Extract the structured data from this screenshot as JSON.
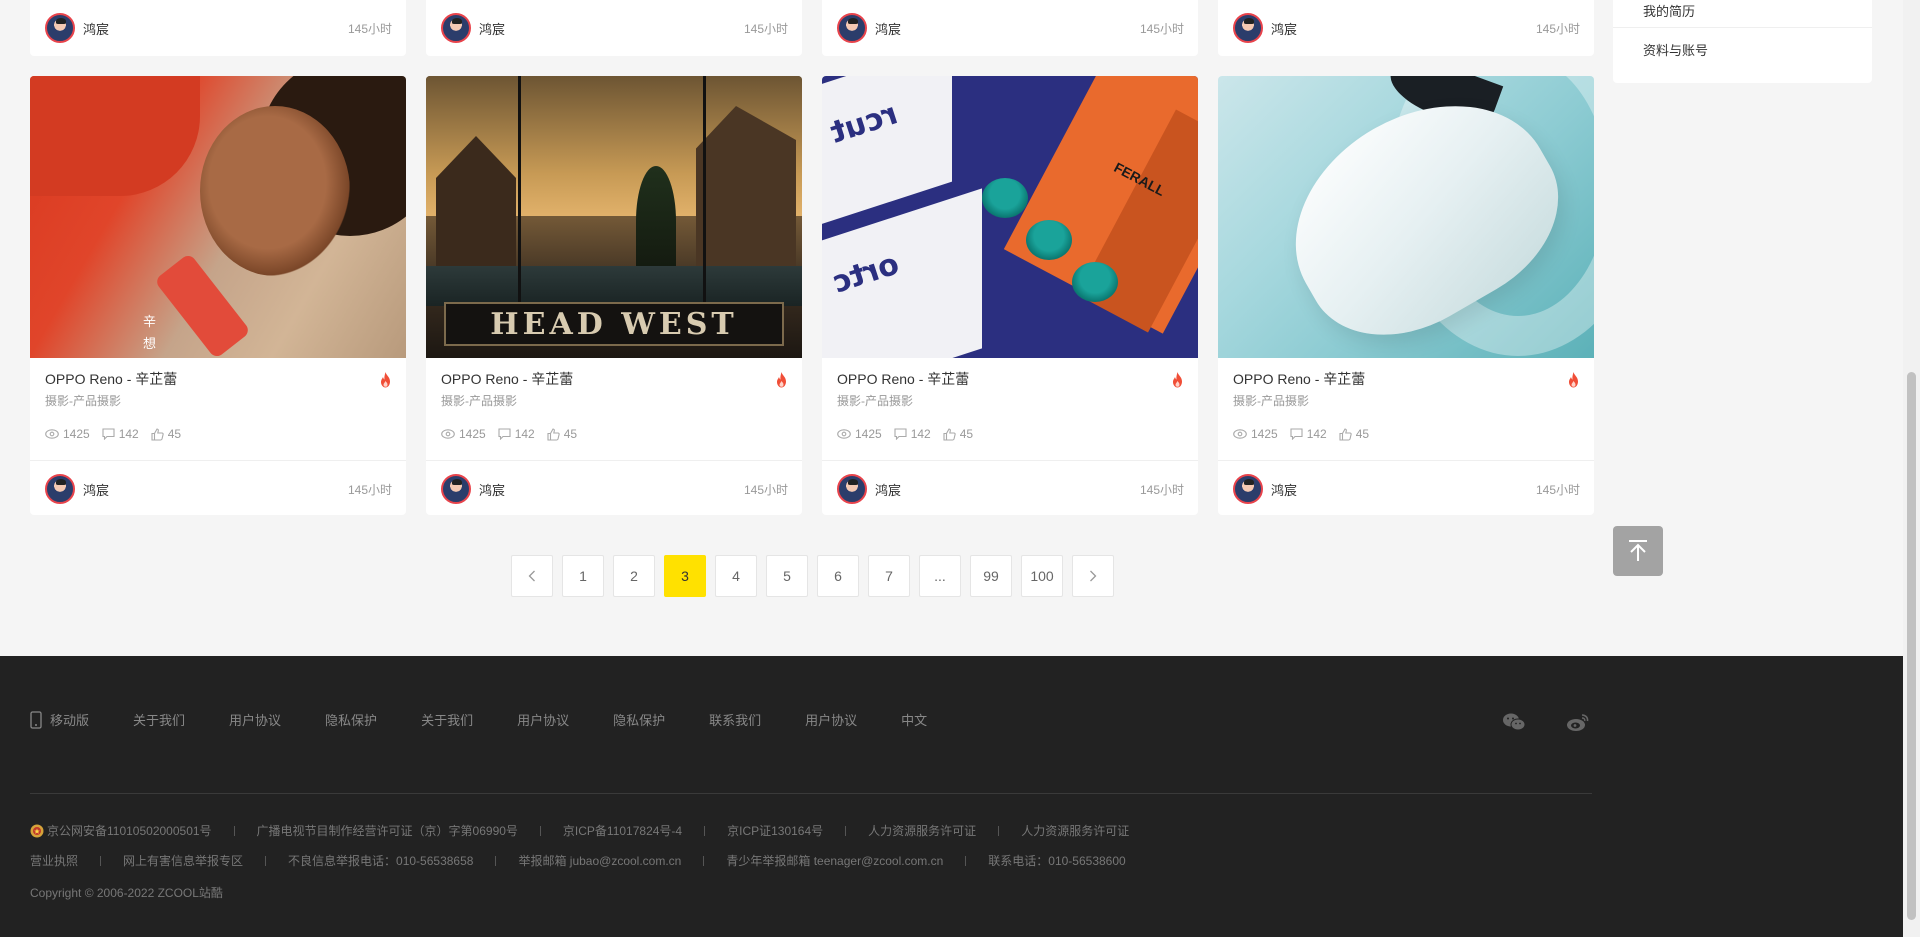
{
  "top_cards": [
    {
      "author": "鸿宸",
      "time": "145小时"
    },
    {
      "author": "鸿宸",
      "time": "145小时"
    },
    {
      "author": "鸿宸",
      "time": "145小时"
    },
    {
      "author": "鸿宸",
      "time": "145小时"
    }
  ],
  "cards": [
    {
      "title": "OPPO Reno - 辛芷蕾",
      "category": "摄影-产品摄影",
      "views": "1425",
      "comments": "142",
      "likes": "45",
      "author": "鸿宸",
      "time": "145小时",
      "thumb_text": "辛\n想"
    },
    {
      "title": "OPPO Reno - 辛芷蕾",
      "category": "摄影-产品摄影",
      "views": "1425",
      "comments": "142",
      "likes": "45",
      "author": "鸿宸",
      "time": "145小时",
      "thumb_text": "HEAD WEST"
    },
    {
      "title": "OPPO Reno - 辛芷蕾",
      "category": "摄影-产品摄影",
      "views": "1425",
      "comments": "142",
      "likes": "45",
      "author": "鸿宸",
      "time": "145小时",
      "thumb_text": "FERALL"
    },
    {
      "title": "OPPO Reno - 辛芷蕾",
      "category": "摄影-产品摄影",
      "views": "1425",
      "comments": "142",
      "likes": "45",
      "author": "鸿宸",
      "time": "145小时",
      "thumb_text": ""
    }
  ],
  "pagination": {
    "pages": [
      "1",
      "2",
      "3",
      "4",
      "5",
      "6",
      "7",
      "...",
      "99",
      "100"
    ],
    "active": "3"
  },
  "sidebar": {
    "items": [
      "我的简历",
      "资料与账号"
    ]
  },
  "footer": {
    "links": [
      "移动版",
      "关于我们",
      "用户协议",
      "隐私保护",
      "关于我们",
      "用户协议",
      "隐私保护",
      "联系我们",
      "用户协议",
      "中文"
    ],
    "row1": [
      "京公网安备11010502000501号",
      "广播电视节目制作经营许可证（京）字第06990号",
      "京ICP备11017824号-4",
      "京ICP证130164号",
      "人力资源服务许可证",
      "人力资源服务许可证"
    ],
    "row2": [
      "营业执照",
      "网上有害信息举报专区",
      "不良信息举报电话：010-56538658",
      "举报邮箱 jubao@zcool.com.cn",
      "青少年举报邮箱 teenager@zcool.com.cn",
      "联系电话：010-56538600"
    ],
    "copyright": "Copyright © 2006-2022 ZCOOL站酷"
  },
  "colors": {
    "accent": "#ffe100",
    "hot": "#f04e37",
    "footer_bg": "#222222",
    "page_bg": "#f5f5f5"
  },
  "icons": {
    "hot": "fire-icon",
    "views": "eye-icon",
    "comments": "comment-icon",
    "likes": "thumbs-up-icon",
    "back_top": "arrow-up-icon",
    "mobile": "phone-icon",
    "wechat": "wechat-icon",
    "weibo": "weibo-icon",
    "police": "police-badge-icon"
  }
}
